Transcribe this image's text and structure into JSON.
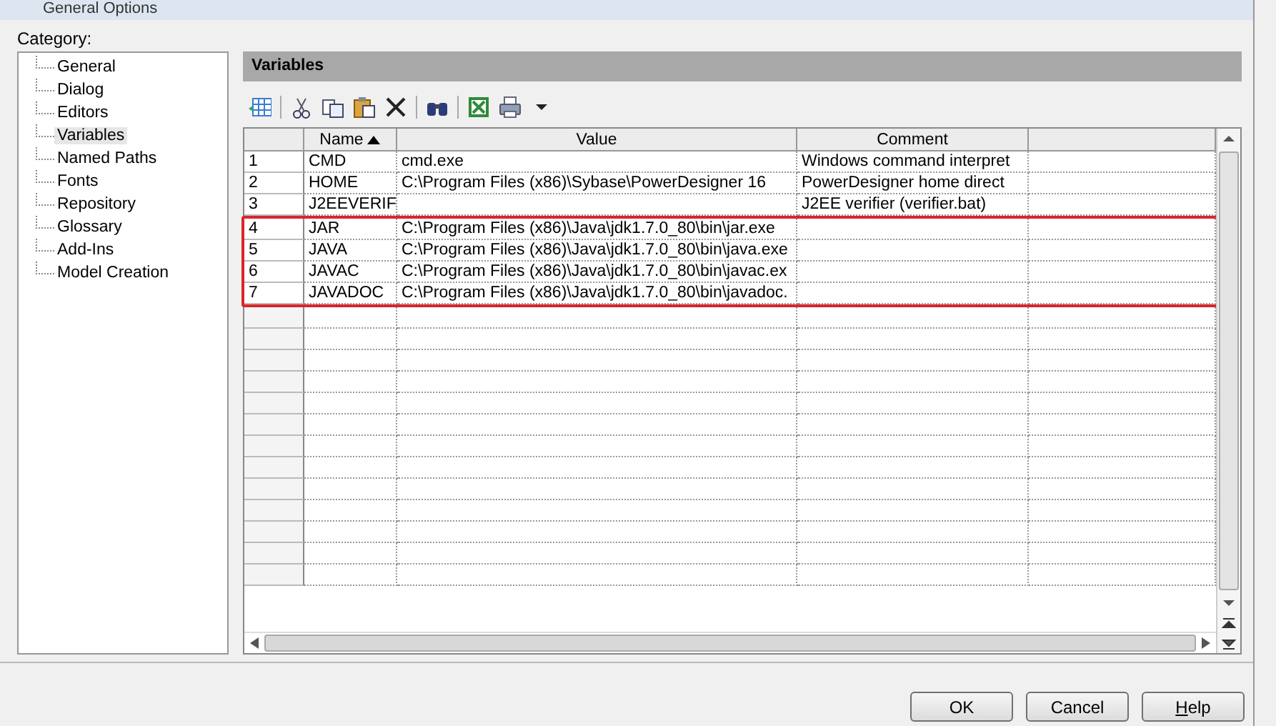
{
  "window": {
    "title": "General Options"
  },
  "category": {
    "label": "Category:",
    "items": [
      {
        "label": "General",
        "selected": false
      },
      {
        "label": "Dialog",
        "selected": false
      },
      {
        "label": "Editors",
        "selected": false
      },
      {
        "label": "Variables",
        "selected": true
      },
      {
        "label": "Named Paths",
        "selected": false
      },
      {
        "label": "Fonts",
        "selected": false
      },
      {
        "label": "Repository",
        "selected": false
      },
      {
        "label": "Glossary",
        "selected": false
      },
      {
        "label": "Add-Ins",
        "selected": false
      },
      {
        "label": "Model Creation",
        "selected": false
      }
    ]
  },
  "panel": {
    "title": "Variables"
  },
  "toolbar": [
    {
      "kind": "grid"
    },
    {
      "kind": "sep"
    },
    {
      "kind": "cut"
    },
    {
      "kind": "copy"
    },
    {
      "kind": "paste"
    },
    {
      "kind": "delete"
    },
    {
      "kind": "sep"
    },
    {
      "kind": "find"
    },
    {
      "kind": "sep"
    },
    {
      "kind": "excel"
    },
    {
      "kind": "print"
    },
    {
      "kind": "caret"
    }
  ],
  "table": {
    "columns": [
      {
        "label": "Name",
        "sorted": true
      },
      {
        "label": "Value",
        "sorted": false
      },
      {
        "label": "Comment",
        "sorted": false
      }
    ],
    "rows": [
      {
        "num": "1",
        "name": "CMD",
        "value": "cmd.exe",
        "comment": "Windows command interpret",
        "highlighted": false
      },
      {
        "num": "2",
        "name": "HOME",
        "value": "C:\\Program Files (x86)\\Sybase\\PowerDesigner 16",
        "comment": "PowerDesigner home direct",
        "highlighted": false
      },
      {
        "num": "3",
        "name": "J2EEVERIF",
        "value": "",
        "comment": "J2EE verifier (verifier.bat)",
        "highlighted": false
      },
      {
        "num": "4",
        "name": "JAR",
        "value": "C:\\Program Files (x86)\\Java\\jdk1.7.0_80\\bin\\jar.exe",
        "comment": "",
        "highlighted": true
      },
      {
        "num": "5",
        "name": "JAVA",
        "value": "C:\\Program Files (x86)\\Java\\jdk1.7.0_80\\bin\\java.exe",
        "comment": "",
        "highlighted": true
      },
      {
        "num": "6",
        "name": "JAVAC",
        "value": "C:\\Program Files (x86)\\Java\\jdk1.7.0_80\\bin\\javac.ex",
        "comment": "",
        "highlighted": true
      },
      {
        "num": "7",
        "name": "JAVADOC",
        "value": "C:\\Program Files (x86)\\Java\\jdk1.7.0_80\\bin\\javadoc.",
        "comment": "",
        "highlighted": true
      }
    ]
  },
  "buttons": [
    "OK",
    "Cancel",
    "Help"
  ]
}
